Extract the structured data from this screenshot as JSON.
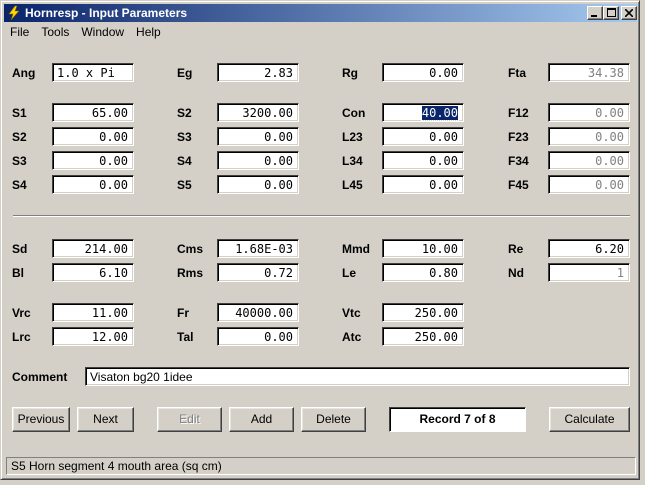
{
  "window": {
    "title": "Hornresp - Input Parameters"
  },
  "menu": [
    "File",
    "Tools",
    "Window",
    "Help"
  ],
  "params": {
    "ang": {
      "label": "Ang",
      "value": "1.0 x Pi"
    },
    "eg": {
      "label": "Eg",
      "value": "2.83"
    },
    "rg": {
      "label": "Rg",
      "value": "0.00"
    },
    "fta": {
      "label": "Fta",
      "value": "34.38"
    },
    "s1a": {
      "label": "S1",
      "value": "65.00"
    },
    "s2a": {
      "label": "S2",
      "value": "0.00"
    },
    "s3a": {
      "label": "S3",
      "value": "0.00"
    },
    "s4a": {
      "label": "S4",
      "value": "0.00"
    },
    "s2b": {
      "label": "S2",
      "value": "3200.00"
    },
    "s3b": {
      "label": "S3",
      "value": "0.00"
    },
    "s4b": {
      "label": "S4",
      "value": "0.00"
    },
    "s5": {
      "label": "S5",
      "value": "0.00"
    },
    "con": {
      "label": "Con",
      "value": "40.00"
    },
    "l23": {
      "label": "L23",
      "value": "0.00"
    },
    "l34": {
      "label": "L34",
      "value": "0.00"
    },
    "l45": {
      "label": "L45",
      "value": "0.00"
    },
    "f12": {
      "label": "F12",
      "value": "0.00"
    },
    "f23": {
      "label": "F23",
      "value": "0.00"
    },
    "f34": {
      "label": "F34",
      "value": "0.00"
    },
    "f45": {
      "label": "F45",
      "value": "0.00"
    },
    "sd": {
      "label": "Sd",
      "value": "214.00"
    },
    "bl": {
      "label": "Bl",
      "value": "6.10"
    },
    "cms": {
      "label": "Cms",
      "value": "1.68E-03"
    },
    "rms": {
      "label": "Rms",
      "value": "0.72"
    },
    "mmd": {
      "label": "Mmd",
      "value": "10.00"
    },
    "le": {
      "label": "Le",
      "value": "0.80"
    },
    "re": {
      "label": "Re",
      "value": "6.20"
    },
    "nd": {
      "label": "Nd",
      "value": "1"
    },
    "vrc": {
      "label": "Vrc",
      "value": "11.00"
    },
    "lrc": {
      "label": "Lrc",
      "value": "12.00"
    },
    "fr": {
      "label": "Fr",
      "value": "40000.00"
    },
    "tal": {
      "label": "Tal",
      "value": "0.00"
    },
    "vtc": {
      "label": "Vtc",
      "value": "250.00"
    },
    "atc": {
      "label": "Atc",
      "value": "250.00"
    }
  },
  "comment": {
    "label": "Comment",
    "value": "Visaton bg20 1idee"
  },
  "buttons": {
    "previous": "Previous",
    "next": "Next",
    "edit": "Edit",
    "add": "Add",
    "delete": "Delete",
    "calculate": "Calculate"
  },
  "record": "Record 7 of 8",
  "status": "S5   Horn segment 4 mouth area  (sq cm)",
  "colors": {
    "face": "#d4d0c8",
    "title_start": "#0a246a",
    "title_end": "#a6caf0",
    "selection": "#0a246a",
    "disabled_text": "#808080"
  }
}
